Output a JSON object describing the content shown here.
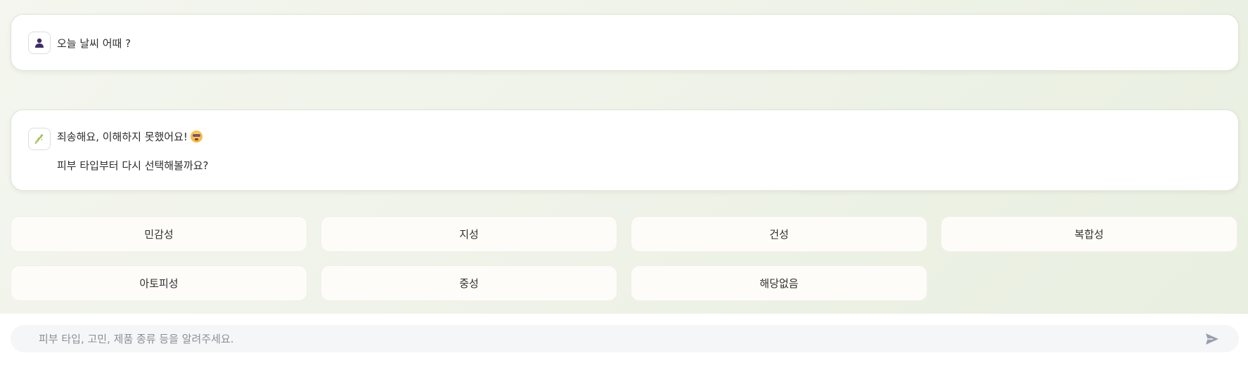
{
  "messages": {
    "user": {
      "text": "오늘 날씨 어때 ?",
      "avatar_icon": "user-icon"
    },
    "bot": {
      "line1": "죄송해요, 이해하지 못했어요!",
      "line2": "피부 타입부터 다시 선택해볼까요?",
      "emoji": "dizzy-face-emoji",
      "avatar_icon": "leaf-sprig-icon"
    }
  },
  "skin_type_options": [
    "민감성",
    "지성",
    "건성",
    "복합성",
    "아토피성",
    "중성",
    "해당없음"
  ],
  "input": {
    "placeholder": "피부 타입, 고민, 제품 종류 등을 알려주세요.",
    "value": "",
    "send_icon": "send-icon"
  },
  "colors": {
    "background": "#eef2e7",
    "bubble": "#ffffff",
    "chip": "#fdfcf8",
    "user_icon": "#3d2d6b",
    "send_icon": "#9a9fae"
  }
}
